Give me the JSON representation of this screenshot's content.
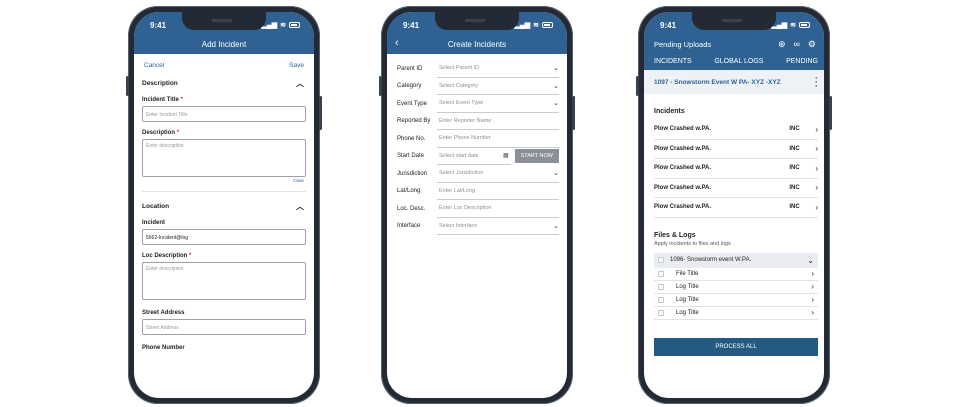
{
  "colors": {
    "brand": "#2f6193",
    "button": "#225a82",
    "required": "#d03030"
  },
  "phone1": {
    "time": "9:41",
    "title": "Add Incident",
    "cancel": "Cancel",
    "save": "Save",
    "description_section": "Description",
    "incident_title_label": "Incident Title",
    "incident_title_placeholder": "Enter Incident Title",
    "description_label": "Description",
    "description_placeholder": "Enter description",
    "clear": "Clear",
    "location_section": "Location",
    "incident_label": "Incident",
    "incident_value": "5662-Incident@log",
    "loc_desc_label": "Loc Description",
    "loc_desc_placeholder": "Enter description",
    "street_label": "Street Address",
    "street_placeholder": "Street Address",
    "phone_label": "Phone Number",
    "required_mark": "*"
  },
  "phone2": {
    "time": "9:41",
    "title": "Create Incidents",
    "fields": [
      {
        "label": "Parent ID",
        "placeholder": "Select Parent ID"
      },
      {
        "label": "Category",
        "placeholder": "Select Category"
      },
      {
        "label": "Event Type",
        "placeholder": "Select Event Type"
      },
      {
        "label": "Reported By",
        "placeholder": "Enter Reporter Name"
      },
      {
        "label": "Phone No.",
        "placeholder": "Enter Phone Number"
      },
      {
        "label": "Start Date",
        "placeholder": "Select start date",
        "button": "START NOW"
      },
      {
        "label": "Jurisdiction",
        "placeholder": "Select Jurisdiction"
      },
      {
        "label": "Lat/Long",
        "placeholder": "Enter Lat/Long"
      },
      {
        "label": "Loc. Desc.",
        "placeholder": "Enter Loc Description"
      },
      {
        "label": "Interface",
        "placeholder": "Select Interface"
      }
    ]
  },
  "phone3": {
    "time": "9:41",
    "title": "Pending Uploads",
    "tabs": [
      "INCIDENTS",
      "GLOBAL LOGS",
      "PENDING"
    ],
    "event": "1097 - Snowstorm Event W PA- XYZ -XYZ",
    "incidents_heading": "Incidents",
    "incidents": [
      {
        "title": "Plow Crashed w.PA.",
        "status": "INC"
      },
      {
        "title": "Plow Crashed w.PA.",
        "status": "INC"
      },
      {
        "title": "Plow Crashed w.PA.",
        "status": "INC"
      },
      {
        "title": "Plow Crashed w.PA.",
        "status": "INC"
      },
      {
        "title": "Plow Crashed w.PA.",
        "status": "INC"
      }
    ],
    "files_heading": "Files & Logs",
    "files_sub": "Apply incidents to files and logs",
    "group": "1096- Snowstorm event W.PA.",
    "items": [
      "File Title",
      "Log Title",
      "Log Title",
      "Log Title"
    ],
    "process": "PROCESS ALL"
  }
}
